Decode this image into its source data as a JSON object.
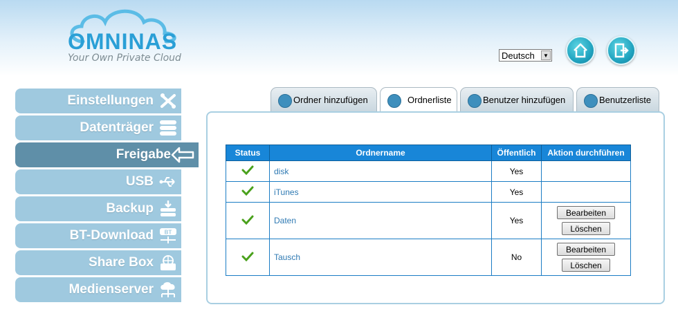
{
  "logo": {
    "brand": "OMNINAS",
    "tagline": "Your Own Private Cloud"
  },
  "header": {
    "language": "Deutsch",
    "home_icon": "home-icon",
    "logout_icon": "logout-icon"
  },
  "sidebar": {
    "items": [
      {
        "label": "Einstellungen",
        "icon": "tools-icon"
      },
      {
        "label": "Datenträger",
        "icon": "disk-stack-icon"
      },
      {
        "label": "Freigabe",
        "icon": "share-arrow-icon"
      },
      {
        "label": "USB",
        "icon": "usb-icon"
      },
      {
        "label": "Backup",
        "icon": "backup-icon"
      },
      {
        "label": "BT-Download",
        "icon": "bt-download-icon"
      },
      {
        "label": "Share Box",
        "icon": "share-box-icon"
      },
      {
        "label": "Medienserver",
        "icon": "media-server-icon"
      }
    ],
    "active_index": 2
  },
  "tabs": [
    {
      "label": "Ordner hinzufügen"
    },
    {
      "label": "Ordnerliste"
    },
    {
      "label": "Benutzer hinzufügen"
    },
    {
      "label": "Benutzerliste"
    }
  ],
  "active_tab": 1,
  "table": {
    "headers": [
      "Status",
      "Ordnername",
      "Öffentlich",
      "Aktion durchführen"
    ],
    "rows": [
      {
        "status": "check-icon",
        "name": "disk",
        "public": "Yes",
        "actions": []
      },
      {
        "status": "check-icon",
        "name": "iTunes",
        "public": "Yes",
        "actions": []
      },
      {
        "status": "check-icon",
        "name": "Daten",
        "public": "Yes",
        "actions": [
          "Bearbeiten",
          "Löschen"
        ]
      },
      {
        "status": "check-icon",
        "name": "Tausch",
        "public": "No",
        "actions": [
          "Bearbeiten",
          "Löschen"
        ]
      }
    ]
  }
}
